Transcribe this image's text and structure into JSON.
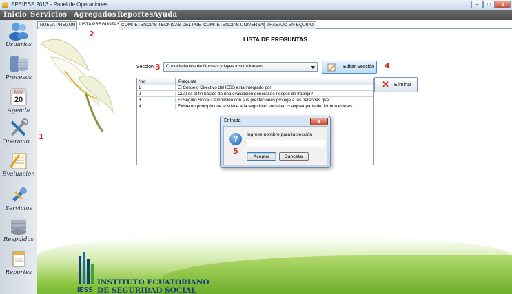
{
  "window": {
    "title": "SPEIESS 2013 - Panel de Operaciones",
    "minimize_label": "–",
    "maximize_label": "□",
    "close_label": "x"
  },
  "menu": [
    "Inicio",
    "Servicios",
    "Agregados",
    "Reportes",
    "Ayuda"
  ],
  "sidebar": [
    {
      "label": "Usuarios",
      "icon": "users-icon"
    },
    {
      "label": "Procesos",
      "icon": "database-icon"
    },
    {
      "label": "Agenda",
      "icon": "calendar-icon"
    },
    {
      "label": "Operacio...",
      "icon": "tools-icon"
    },
    {
      "label": "Evaluación",
      "icon": "notepad-icon"
    },
    {
      "label": "Servicios",
      "icon": "wrench-icon"
    },
    {
      "label": "Respaldos",
      "icon": "server-icon"
    },
    {
      "label": "Reportes",
      "icon": "report-icon"
    }
  ],
  "calendar_icon": {
    "month": "MAY",
    "day": "20"
  },
  "tabs": [
    "NUEVA PREGUNTA",
    "LISTA PREGUNTAS",
    "COMPETENCIAS TÉCNICAS DEL PUESTO",
    "COMPETENCIAS UNIVERSALES",
    "TRABAJO EN EQUIPO"
  ],
  "active_tab": "LISTA PREGUNTAS",
  "panel": {
    "heading": "LISTA DE PREGUNTAS",
    "section_label": "Seccion:",
    "section_value": "Conocimientos de Normas y leyes institucionales",
    "edit_button": "Editar Sección",
    "delete_button": "Eliminar"
  },
  "table": {
    "columns": [
      "Nro",
      "Pregunta"
    ],
    "rows": [
      [
        "1",
        "El Consejo Directivo del IESS esta integrado por:"
      ],
      [
        "2",
        "Cuál es el fin básico de una evaluación general de riesgos de trabajo?"
      ],
      [
        "3",
        "El Seguro Social Campesino con sus prestaciones protege a las personas que:"
      ],
      [
        "4",
        "Existe un principio que sostiene a la seguridad social en cualquier parte del Mundo este es:"
      ]
    ]
  },
  "dialog": {
    "title": "Entrada",
    "close_label": "x",
    "prompt": "Ingrese nombre para la sección",
    "input_value": "",
    "ok_button": "Aceptar",
    "cancel_button": "Cancelar"
  },
  "annotations": [
    "1",
    "2",
    "3",
    "4",
    "5"
  ],
  "logo": {
    "acronym": "IESS",
    "line1": "INSTITUTO ECUATORIANO",
    "line2": "DE SEGURIDAD SOCIAL"
  },
  "colors": {
    "annotation": "#e0241b",
    "menubar": "#555555",
    "brand": "#14407a",
    "grass": "#8cc63f"
  }
}
